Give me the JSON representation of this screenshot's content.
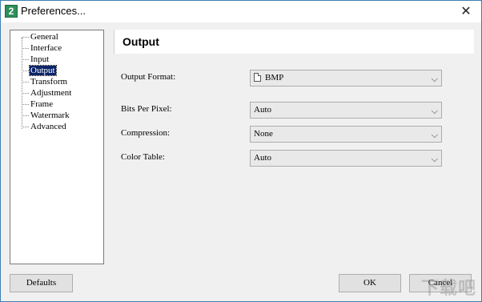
{
  "window": {
    "title": "Preferences...",
    "app_icon_text": "2",
    "close_glyph": "✕"
  },
  "tree": {
    "items": [
      {
        "label": "General"
      },
      {
        "label": "Interface"
      },
      {
        "label": "Input"
      },
      {
        "label": "Output",
        "selected": true
      },
      {
        "label": "Transform"
      },
      {
        "label": "Adjustment"
      },
      {
        "label": "Frame"
      },
      {
        "label": "Watermark"
      },
      {
        "label": "Advanced"
      }
    ]
  },
  "panel": {
    "title": "Output",
    "fields": {
      "output_format": {
        "label": "Output Format:",
        "value": "BMP"
      },
      "bits_per_pixel": {
        "label": "Bits Per Pixel:",
        "value": "Auto"
      },
      "compression": {
        "label": "Compression:",
        "value": "None"
      },
      "color_table": {
        "label": "Color Table:",
        "value": "Auto"
      }
    }
  },
  "buttons": {
    "defaults": "Defaults",
    "ok": "OK",
    "cancel": "Cancel"
  },
  "watermark_text": "下载吧"
}
